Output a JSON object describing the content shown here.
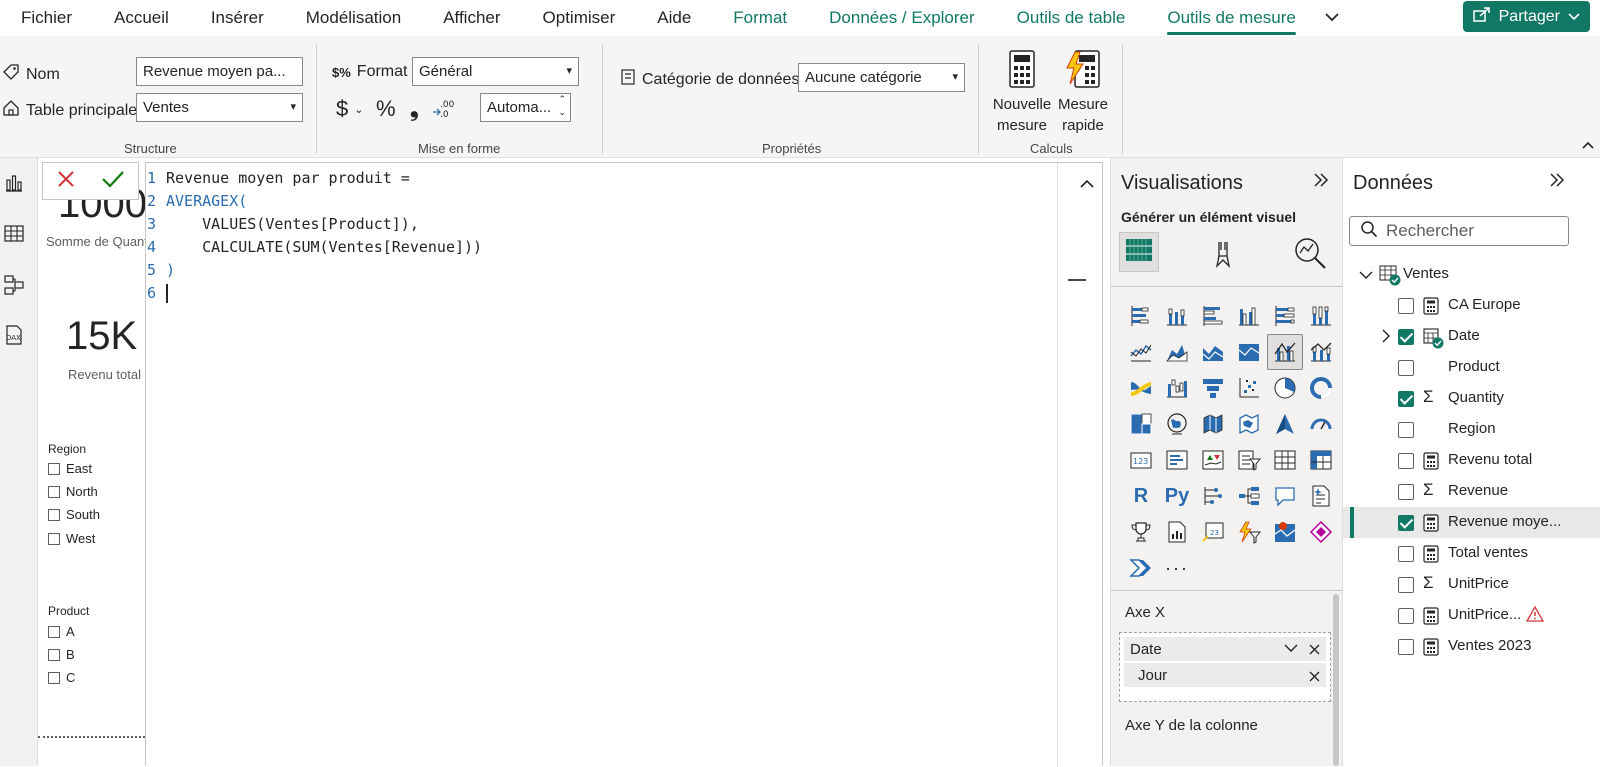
{
  "menu": {
    "items": [
      {
        "label": "Fichier"
      },
      {
        "label": "Accueil"
      },
      {
        "label": "Insérer"
      },
      {
        "label": "Modélisation"
      },
      {
        "label": "Afficher"
      },
      {
        "label": "Optimiser"
      },
      {
        "label": "Aide"
      }
    ],
    "context_tabs": [
      {
        "label": "Format"
      },
      {
        "label": "Données / Explorer"
      },
      {
        "label": "Outils de table"
      },
      {
        "label": "Outils de mesure"
      }
    ],
    "active_tab": "Outils de mesure",
    "share_label": "Partager"
  },
  "ribbon": {
    "structure": {
      "name_label": "Nom",
      "name_value": "Revenue moyen pa...",
      "home_table_label": "Table principale",
      "home_table_value": "Ventes",
      "group_label": "Structure"
    },
    "formatting": {
      "format_label": "Format",
      "format_value": "Général",
      "currency_symbol": "$",
      "percent_symbol": "%",
      "comma_symbol": "❟",
      "decimals_value": "Automa...",
      "group_label": "Mise en forme"
    },
    "properties": {
      "data_category_label": "Catégorie de données",
      "data_category_value": "Aucune catégorie",
      "group_label": "Propriétés"
    },
    "calculations": {
      "new_measure_line1": "Nouvelle",
      "new_measure_line2": "mesure",
      "quick_measure_line1": "Mesure",
      "quick_measure_line2": "rapide",
      "group_label": "Calculs"
    }
  },
  "report": {
    "card1_value": "1000",
    "card1_label": "Somme de Quantity",
    "card2_value": "15K",
    "card2_label": "Revenu total",
    "region_slicer": {
      "title": "Region",
      "options": [
        "East",
        "North",
        "South",
        "West"
      ]
    },
    "product_slicer": {
      "title": "Product",
      "options": [
        "A",
        "B",
        "C"
      ]
    }
  },
  "formula": {
    "lines": [
      {
        "n": "1",
        "text": "Revenue moyen par produit ="
      },
      {
        "n": "2",
        "text": "AVERAGEX("
      },
      {
        "n": "3",
        "text": "    VALUES(Ventes[Product]),"
      },
      {
        "n": "4",
        "text": "    CALCULATE(SUM(Ventes[Revenue]))"
      },
      {
        "n": "5",
        "text": ")"
      },
      {
        "n": "6",
        "text": ""
      }
    ]
  },
  "visualizations": {
    "title": "Visualisations",
    "build_label": "Générer un élément visuel",
    "wells": [
      {
        "label": "Axe X",
        "fields": [
          {
            "name": "Date"
          },
          {
            "name": "Jour"
          }
        ]
      },
      {
        "label": "Axe Y de la colonne"
      }
    ]
  },
  "data_pane": {
    "title": "Données",
    "search_placeholder": "Rechercher",
    "table_name": "Ventes",
    "fields": [
      {
        "label": "CA Europe",
        "type": "measure",
        "checked": false
      },
      {
        "label": "Date",
        "type": "date",
        "checked": true
      },
      {
        "label": "Product",
        "type": "text",
        "checked": false
      },
      {
        "label": "Quantity",
        "type": "sum",
        "checked": true
      },
      {
        "label": "Region",
        "type": "text",
        "checked": false
      },
      {
        "label": "Revenu total",
        "type": "measure",
        "checked": false
      },
      {
        "label": "Revenue",
        "type": "sum",
        "checked": false
      },
      {
        "label": "Revenue moye...",
        "type": "measure",
        "checked": true,
        "selected": true
      },
      {
        "label": "Total ventes",
        "type": "measure",
        "checked": false
      },
      {
        "label": "UnitPrice",
        "type": "sum",
        "checked": false
      },
      {
        "label": "UnitPrice...",
        "type": "measure",
        "checked": false,
        "warning": true
      },
      {
        "label": "Ventes 2023",
        "type": "measure",
        "checked": false
      }
    ]
  },
  "colors": {
    "accent": "#117865",
    "code_keyword": "#2b6cb0",
    "cancel": "#d13438",
    "commit": "#107c10"
  }
}
